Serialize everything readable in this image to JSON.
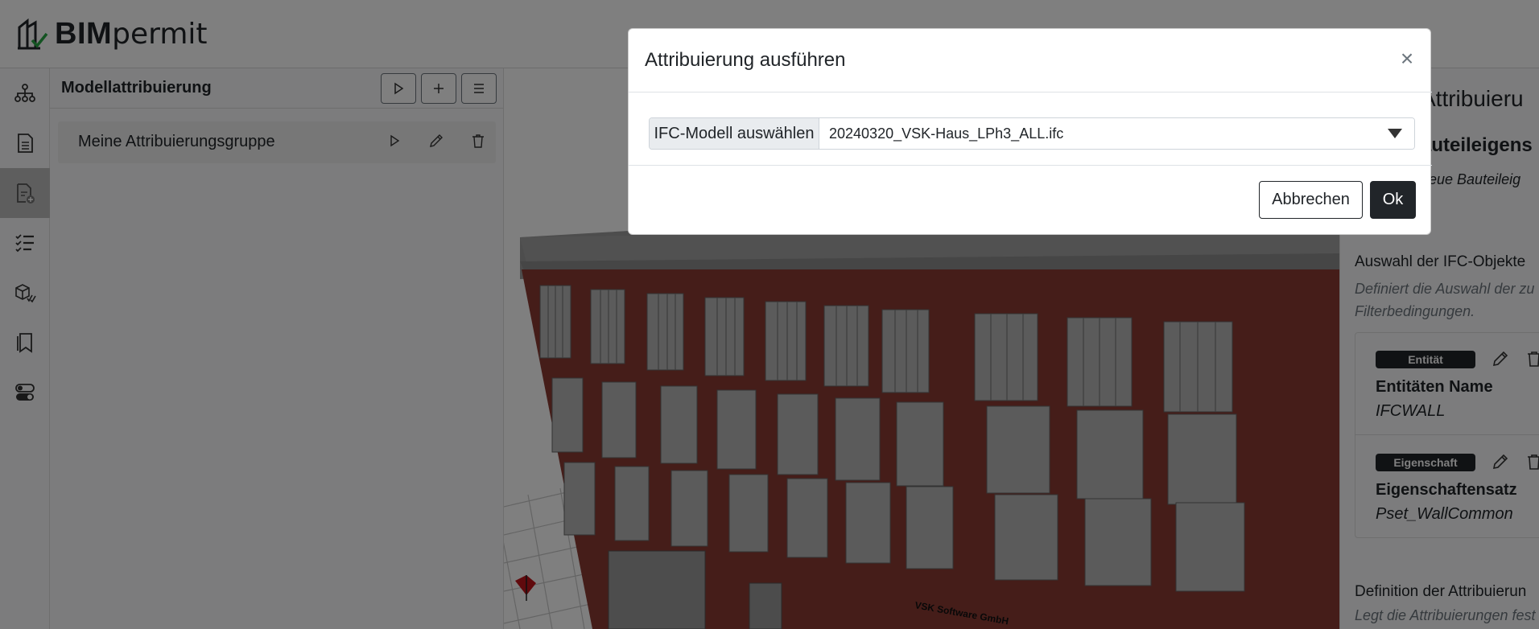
{
  "header": {
    "logo_bold": "BIM",
    "logo_light": "permit"
  },
  "rail": {
    "items": [
      {
        "icon": "network-icon"
      },
      {
        "icon": "document-icon"
      },
      {
        "icon": "document-edit-icon",
        "active": true
      },
      {
        "icon": "checklist-icon"
      },
      {
        "icon": "cube-check-icon"
      },
      {
        "icon": "bookmarks-icon"
      },
      {
        "icon": "toggles-icon"
      }
    ]
  },
  "panel": {
    "title": "Modellattribuierung",
    "actions": [
      "play-icon",
      "plus-icon",
      "menu-icon"
    ],
    "group": {
      "label": "Meine Attribuierungsgruppe"
    }
  },
  "viewer": {
    "building_label": "VSK Software GmbH"
  },
  "right_panel": {
    "title": "Attribuieru",
    "subtitle": "auteileigens",
    "description": "neue Bauteileig",
    "selection_title": "Auswahl der IFC-Objekte",
    "selection_desc": "Definiert die Auswahl der zu Filterbedingungen.",
    "cards": [
      {
        "badge": "Entität",
        "key": "Entitäten Name",
        "value": "IFCWALL"
      },
      {
        "badge": "Eigenschaft",
        "key": "Eigenschaftensatz",
        "value": "Pset_WallCommon"
      }
    ],
    "definition_title": "Definition der Attribuierun",
    "definition_desc": "Legt die Attribuierungen fest"
  },
  "modal": {
    "title": "Attribuierung ausführen",
    "close": "×",
    "input_label": "IFC-Modell auswählen",
    "selected_model": "20240320_VSK-Haus_LPh3_ALL.ifc",
    "cancel_label": "Abbrechen",
    "ok_label": "Ok"
  },
  "colors": {
    "backdrop": "rgba(0,0,0,0.5)",
    "primary_dark": "#212529",
    "brick": "#8a3a33"
  }
}
